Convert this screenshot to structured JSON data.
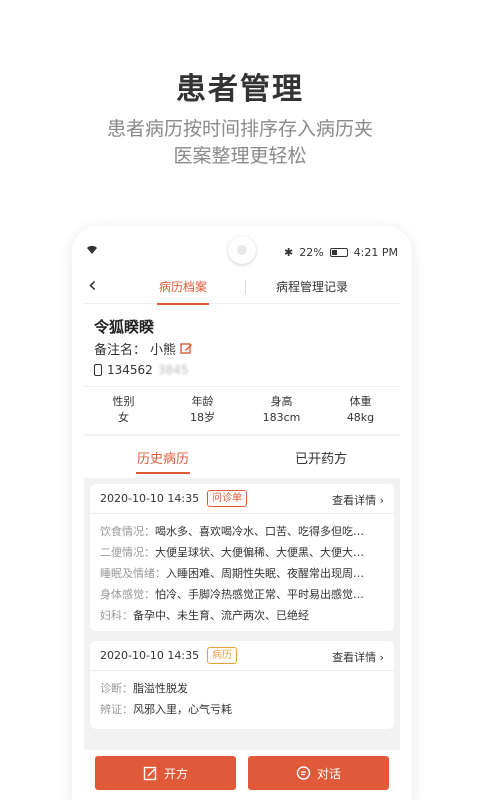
{
  "promo": {
    "title": "患者管理",
    "subtitle_line1": "患者病历按时间排序存入病历夹",
    "subtitle_line2": "医案整理更轻松"
  },
  "status_bar": {
    "signal": "wifi-icon",
    "battery_percent": "22%",
    "time": "4:21 PM"
  },
  "navbar": {
    "back": "‹",
    "tabs": [
      {
        "label": "病历档案",
        "active": true
      },
      {
        "label": "病程管理记录",
        "active": false
      }
    ]
  },
  "patient": {
    "name": "令狐睽睽",
    "note_label": "备注名：",
    "note_value": "小熊",
    "phone_visible": "134562",
    "phone_masked": "3845"
  },
  "stats": [
    {
      "label": "性别",
      "value": "女"
    },
    {
      "label": "年龄",
      "value": "18岁"
    },
    {
      "label": "身高",
      "value": "183cm"
    },
    {
      "label": "体重",
      "value": "48kg"
    }
  ],
  "records_tabs": [
    {
      "label": "历史病历",
      "active": true
    },
    {
      "label": "已开药方",
      "active": false
    }
  ],
  "cards": [
    {
      "date": "2020-10-10 14:35",
      "tag": "问诊单",
      "detail": "查看详情 ›",
      "rows": [
        {
          "label": "饮食情况：",
          "value": "喝水多、喜欢喝冷水、口苦、吃得多但吃…"
        },
        {
          "label": "二便情况：",
          "value": "大便呈球状、大便偏稀、大便黑、大便大…"
        },
        {
          "label": "睡眠及情绪：",
          "value": "入睡困难、周期性失眠、夜醒常出现周…"
        },
        {
          "label": "身体感觉：",
          "value": "怕冷、手脚冷热感觉正常、平时易出感觉…"
        },
        {
          "label": "妇科：",
          "value": "备孕中、未生育、流产两次、已绝经"
        }
      ]
    },
    {
      "date": "2020-10-10 14:35",
      "tag": "病历",
      "detail": "查看详情 ›",
      "rows": [
        {
          "label": "诊断：",
          "value": "脂溢性脱发"
        },
        {
          "label": "辨证：",
          "value": "风邪入里，心气亏耗"
        }
      ]
    }
  ],
  "actions": {
    "prescribe": "开方",
    "chat": "对话"
  },
  "colors": {
    "accent": "#e05a3a",
    "tag_yellow": "#e6a23c"
  }
}
